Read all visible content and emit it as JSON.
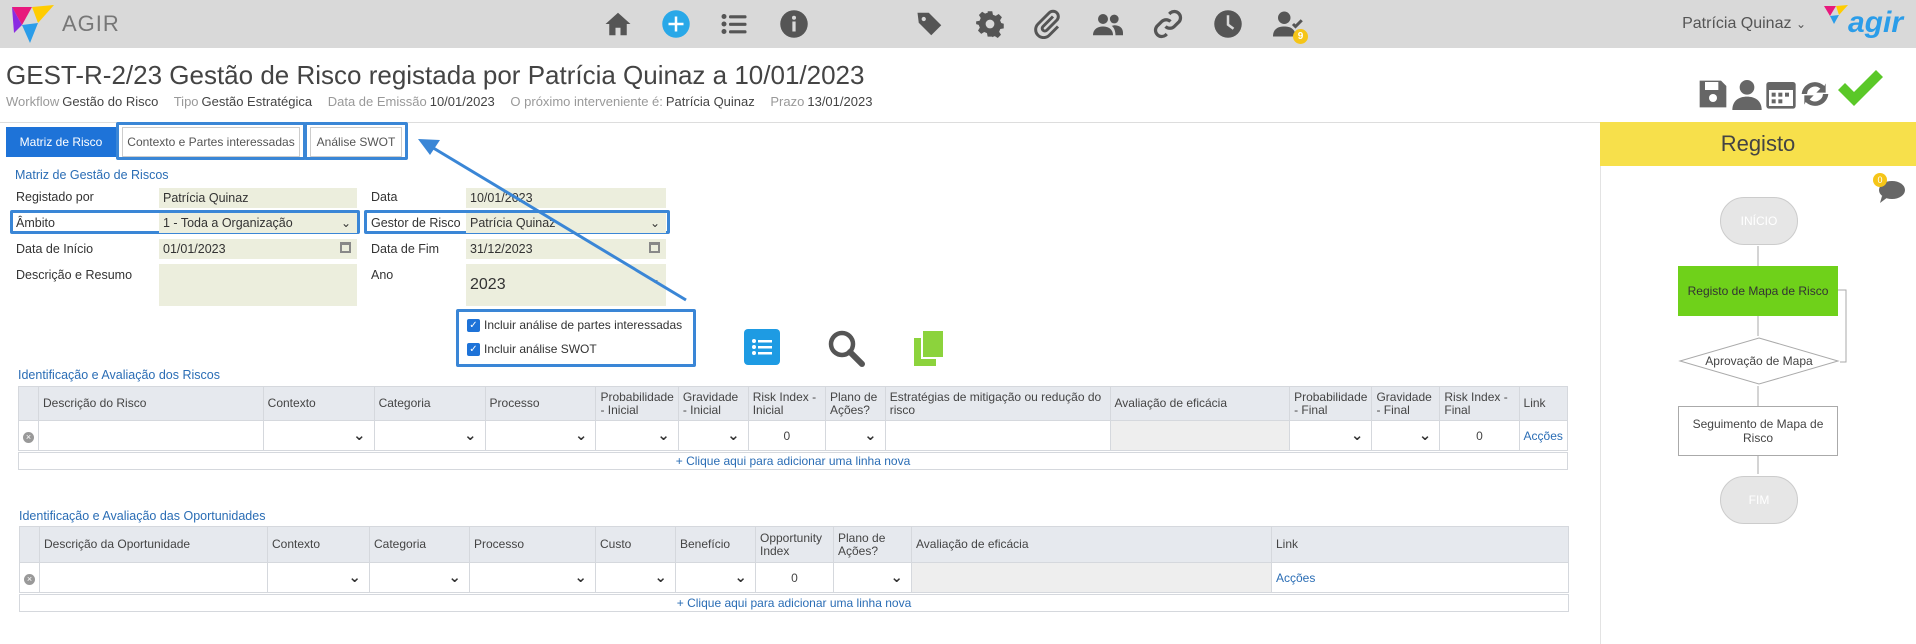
{
  "app": {
    "name": "AGIR",
    "logo_text": "agir",
    "user": "Patrícia Quinaz",
    "notif_count": "9"
  },
  "nav_icons": [
    "home-icon",
    "add-icon",
    "list-icon",
    "info-icon",
    "tags-icon",
    "gear-icon",
    "paperclip-icon",
    "users-icon",
    "link-icon",
    "clock-icon",
    "user-check-icon"
  ],
  "header": {
    "title": "GEST-R-2/23 Gestão de Risco registada por Patrícia Quinaz a 10/01/2023",
    "meta": [
      {
        "label": "Workflow",
        "value": "Gestão do Risco"
      },
      {
        "label": "Tipo",
        "value": "Gestão Estratégica"
      },
      {
        "label": "Data de Emissão",
        "value": "10/01/2023"
      },
      {
        "label": "O próximo interveniente é:",
        "value": "Patrícia Quinaz"
      },
      {
        "label": "Prazo",
        "value": "13/01/2023"
      }
    ]
  },
  "tabs": [
    {
      "label": "Matriz de Risco",
      "active": true
    },
    {
      "label": "Contexto e Partes interessadas",
      "active": false
    },
    {
      "label": "Análise SWOT",
      "active": false
    }
  ],
  "form": {
    "section": "Matriz de Gestão de Riscos",
    "registado_por": {
      "label": "Registado por",
      "value": "Patrícia Quinaz"
    },
    "data": {
      "label": "Data",
      "value": "10/01/2023"
    },
    "ambito": {
      "label": "Âmbito",
      "value": "1 - Toda a Organização"
    },
    "gestor": {
      "label": "Gestor de Risco",
      "value": "Patrícia Quinaz"
    },
    "data_inicio": {
      "label": "Data de Início",
      "value": "01/01/2023"
    },
    "data_fim": {
      "label": "Data de Fim",
      "value": "31/12/2023"
    },
    "descricao": {
      "label": "Descrição e Resumo",
      "value": ""
    },
    "ano": {
      "label": "Ano",
      "value": "2023"
    },
    "check1": "Incluir análise de partes interessadas",
    "check2": "Incluir análise SWOT"
  },
  "risks": {
    "title": "Identificação e Avaliação dos Riscos",
    "headers": [
      "Descrição do Risco",
      "Contexto",
      "Categoria",
      "Processo",
      "Probabilidade - Inicial",
      "Gravidade - Inicial",
      "Risk Index - Inicial",
      "Plano de Ações?",
      "Estratégias de mitigação ou redução do risco",
      "Avaliação de eficácia",
      "Probabilidade - Final",
      "Gravidade - Final",
      "Risk Index - Final",
      "Link"
    ],
    "row": {
      "risk_index_initial": "0",
      "risk_index_final": "0",
      "link": "Acções"
    },
    "add_row": "+ Clique aqui para adicionar uma linha nova"
  },
  "opps": {
    "title": "Identificação e Avaliação das Oportunidades",
    "headers": [
      "Descrição da Oportunidade",
      "Contexto",
      "Categoria",
      "Processo",
      "Custo",
      "Benefício",
      "Opportunity Index",
      "Plano de Ações?",
      "Avaliação de eficácia",
      "Link"
    ],
    "row": {
      "opp_index": "0",
      "link": "Acções"
    },
    "add_row": "+ Clique aqui para adicionar uma linha nova"
  },
  "panel": {
    "title": "Registo",
    "comments": "0",
    "flow": {
      "start": "INÍCIO",
      "step1": "Registo de Mapa de Risco",
      "decision": "Aprovação de Mapa",
      "step2": "Seguimento de Mapa de Risco",
      "end": "FIM"
    }
  },
  "colors": {
    "accent": "#1e73d8",
    "highlight": "#3a86d6",
    "panel_header": "#f7e04b",
    "active_step": "#6fd11a",
    "save_check": "#5ac828"
  }
}
